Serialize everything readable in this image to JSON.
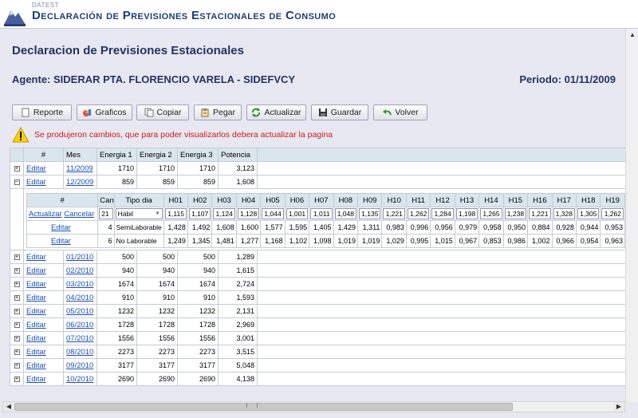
{
  "header": {
    "app_small": "DATEST",
    "title": "Declaración de Previsiones Estacionales de Consumo"
  },
  "page": {
    "heading": "Declaracion de Previsiones Estacionales",
    "agent": "Agente: SIDERAR PTA. FLORENCIO VARELA - SIDEFVCY",
    "period": "Periodo: 01/11/2009"
  },
  "toolbar": {
    "reporte": "Reporte",
    "graficos": "Graficos",
    "copiar": "Copiar",
    "pegar": "Pegar",
    "actualizar": "Actualizar",
    "guardar": "Guardar",
    "volver": "Volver"
  },
  "warning": "Se produjeron cambios, que para poder visualizarlos debera actualizar la pagina",
  "main_table": {
    "headers": [
      "#",
      "Mes",
      "Energia 1",
      "Energia 2",
      "Energia 3",
      "Potencia"
    ],
    "edit_label": "Editar",
    "rows": [
      {
        "mes": "11/2009",
        "e1": "1710",
        "e2": "1710",
        "e3": "1710",
        "pot": "3,123",
        "expanded": false
      },
      {
        "mes": "12/2009",
        "e1": "859",
        "e2": "859",
        "e3": "859",
        "pot": "1,608",
        "expanded": true
      },
      {
        "mes": "01/2010",
        "e1": "500",
        "e2": "500",
        "e3": "500",
        "pot": "1,289",
        "expanded": false
      },
      {
        "mes": "02/2010",
        "e1": "940",
        "e2": "940",
        "e3": "940",
        "pot": "1,615",
        "expanded": false
      },
      {
        "mes": "03/2010",
        "e1": "1674",
        "e2": "1674",
        "e3": "1674",
        "pot": "2,724",
        "expanded": false
      },
      {
        "mes": "04/2010",
        "e1": "910",
        "e2": "910",
        "e3": "910",
        "pot": "1,593",
        "expanded": false
      },
      {
        "mes": "05/2010",
        "e1": "1232",
        "e2": "1232",
        "e3": "1232",
        "pot": "2,131",
        "expanded": false
      },
      {
        "mes": "06/2010",
        "e1": "1728",
        "e2": "1728",
        "e3": "1728",
        "pot": "2,969",
        "expanded": false
      },
      {
        "mes": "07/2010",
        "e1": "1556",
        "e2": "1556",
        "e3": "1556",
        "pot": "3,001",
        "expanded": false
      },
      {
        "mes": "08/2010",
        "e1": "2273",
        "e2": "2273",
        "e3": "2273",
        "pot": "3,515",
        "expanded": false
      },
      {
        "mes": "09/2010",
        "e1": "3177",
        "e2": "3177",
        "e3": "3177",
        "pot": "5,048",
        "expanded": false
      },
      {
        "mes": "10/2010",
        "e1": "2690",
        "e2": "2690",
        "e3": "2690",
        "pot": "4,138",
        "expanded": false
      }
    ]
  },
  "detail_table": {
    "headers": [
      "#",
      "Cant",
      "Tipo dia",
      "H01",
      "H02",
      "H03",
      "H04",
      "H05",
      "H06",
      "H07",
      "H08",
      "H09",
      "H10",
      "H11",
      "H12",
      "H13",
      "H14",
      "H15",
      "H16",
      "H17",
      "H18",
      "H19"
    ],
    "actualizar_label": "Actualizar",
    "cancelar_label": "Cancelar",
    "editar_label": "Editar",
    "edit_row": {
      "cant": "21",
      "tipo": "Hábil",
      "values": [
        "1,115",
        "1,107",
        "1,124",
        "1,128",
        "1,044",
        "1,001",
        "1,011",
        "1,048",
        "1,135",
        "1,221",
        "1,262",
        "1,284",
        "1,198",
        "1,265",
        "1,238",
        "1,221",
        "1,328",
        "1,305",
        "1,262"
      ]
    },
    "rows": [
      {
        "cant": "4",
        "tipo": "SemiLaborable",
        "values": [
          "1,428",
          "1,492",
          "1,608",
          "1,600",
          "1,577",
          "1,595",
          "1,405",
          "1,429",
          "1,311",
          "0,983",
          "0,996",
          "0,956",
          "0,979",
          "0,958",
          "0,950",
          "0,884",
          "0,928",
          "0,944",
          "0,953"
        ]
      },
      {
        "cant": "6",
        "tipo": "No Laborable",
        "values": [
          "1,249",
          "1,345",
          "1,481",
          "1,277",
          "1,168",
          "1,102",
          "1,098",
          "1,019",
          "1,019",
          "1,029",
          "0,995",
          "1,015",
          "0,967",
          "0,853",
          "0,986",
          "1,002",
          "0,966",
          "0,954",
          "0,963"
        ]
      }
    ]
  },
  "colors": {
    "header_blue": "#1e3d7b",
    "heading_blue": "#24345f",
    "warning_red": "#cc1b1b",
    "link_blue": "#1d4fb4",
    "table_header_bg": "#d9e6ee",
    "page_bg": "#e7e8f2"
  },
  "icons": {
    "app_logo": "mountain-logo-icon",
    "reporte": "document-icon",
    "graficos": "chart-icon",
    "copiar": "copy-icon",
    "pegar": "paste-icon",
    "actualizar": "refresh-icon",
    "guardar": "save-icon",
    "volver": "back-arrow-icon",
    "warning": "warning-triangle-icon"
  }
}
